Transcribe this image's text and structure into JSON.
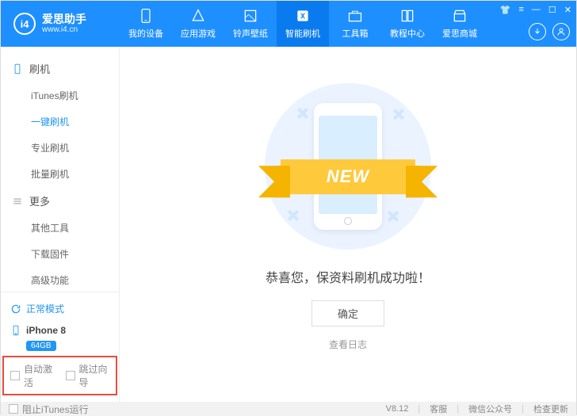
{
  "brand": {
    "title": "爱思助手",
    "subtitle": "www.i4.cn",
    "logo_text": "i4"
  },
  "nav": [
    {
      "label": "我的设备"
    },
    {
      "label": "应用游戏"
    },
    {
      "label": "铃声壁纸"
    },
    {
      "label": "智能刷机"
    },
    {
      "label": "工具箱"
    },
    {
      "label": "教程中心"
    },
    {
      "label": "爱思商城"
    }
  ],
  "sidebar": {
    "section1": "刷机",
    "items1": [
      "iTunes刷机",
      "一键刷机",
      "专业刷机",
      "批量刷机"
    ],
    "section2": "更多",
    "items2": [
      "其他工具",
      "下载固件",
      "高级功能"
    ],
    "mode": "正常模式",
    "device": "iPhone 8",
    "storage": "64GB",
    "opt1": "自动激活",
    "opt2": "跳过向导"
  },
  "main": {
    "ribbon": "NEW",
    "message": "恭喜您，保资料刷机成功啦！",
    "ok": "确定",
    "log": "查看日志"
  },
  "footer": {
    "block_itunes": "阻止iTunes运行",
    "version": "V8.12",
    "support": "客服",
    "wechat": "微信公众号",
    "update": "检查更新"
  }
}
